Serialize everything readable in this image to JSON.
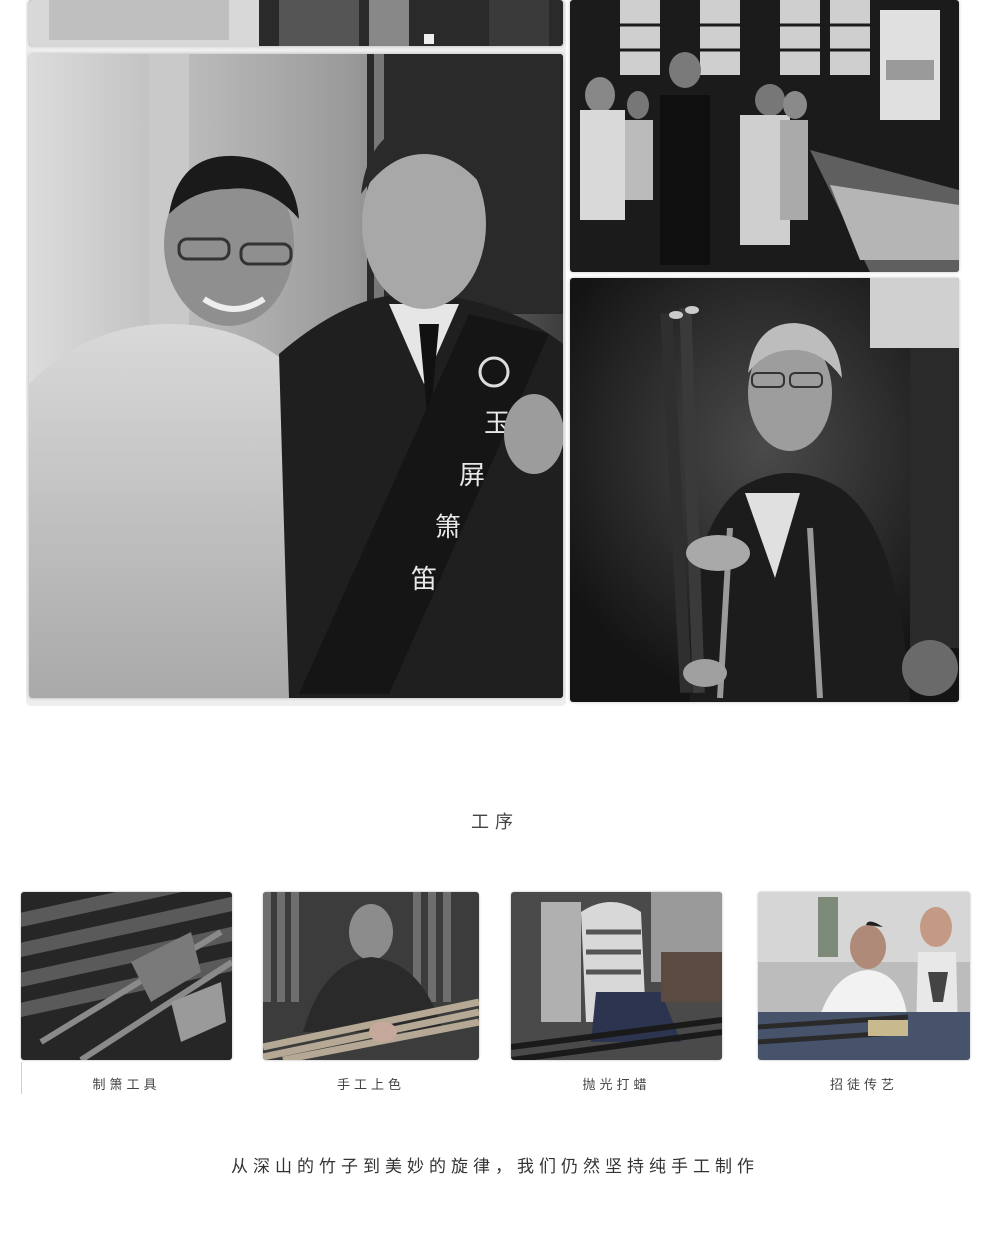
{
  "gallery": {
    "photos": [
      {
        "name": "gallery-photo-top-left-crop",
        "alt": ""
      },
      {
        "name": "gallery-photo-visit-portrait",
        "alt": ""
      },
      {
        "name": "gallery-photo-exhibition-visitors",
        "alt": ""
      },
      {
        "name": "gallery-photo-artisan-holding-flutes",
        "alt": ""
      }
    ],
    "banner_text": "玉屏箫笛"
  },
  "process": {
    "title": "工序",
    "items": [
      {
        "label": "制箫工具"
      },
      {
        "label": "手工上色"
      },
      {
        "label": "抛光打蜡"
      },
      {
        "label": "招徒传艺"
      }
    ]
  },
  "tagline": "从深山的竹子到美妙的旋律，我们仍然坚持纯手工制作"
}
